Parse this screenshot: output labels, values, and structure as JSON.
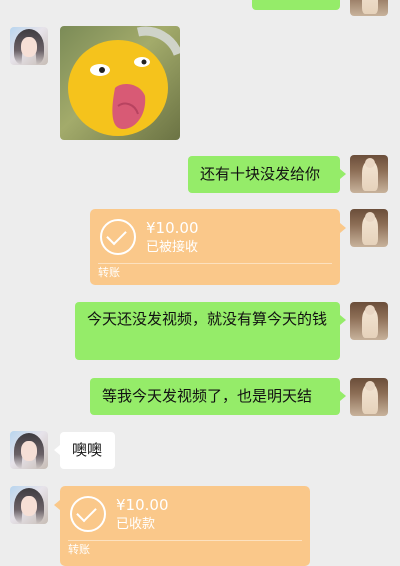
{
  "messages": [
    {
      "side": "right",
      "type": "text",
      "text": "还有十块没发给你"
    },
    {
      "side": "right",
      "type": "transfer",
      "amount": "¥10.00",
      "status": "已被接收",
      "label": "转账"
    },
    {
      "side": "right",
      "type": "text",
      "text": "今天还没发视频，就没有算今天的钱"
    },
    {
      "side": "right",
      "type": "text",
      "text": "等我今天发视频了，也是明天结"
    },
    {
      "side": "left",
      "type": "text",
      "text": "噢噢"
    },
    {
      "side": "left",
      "type": "transfer",
      "amount": "¥10.00",
      "status": "已收款",
      "label": "转账"
    }
  ],
  "colors": {
    "background": "#ededed",
    "bubble_green": "#95ec69",
    "bubble_white": "#ffffff",
    "transfer": "#fac88a"
  }
}
